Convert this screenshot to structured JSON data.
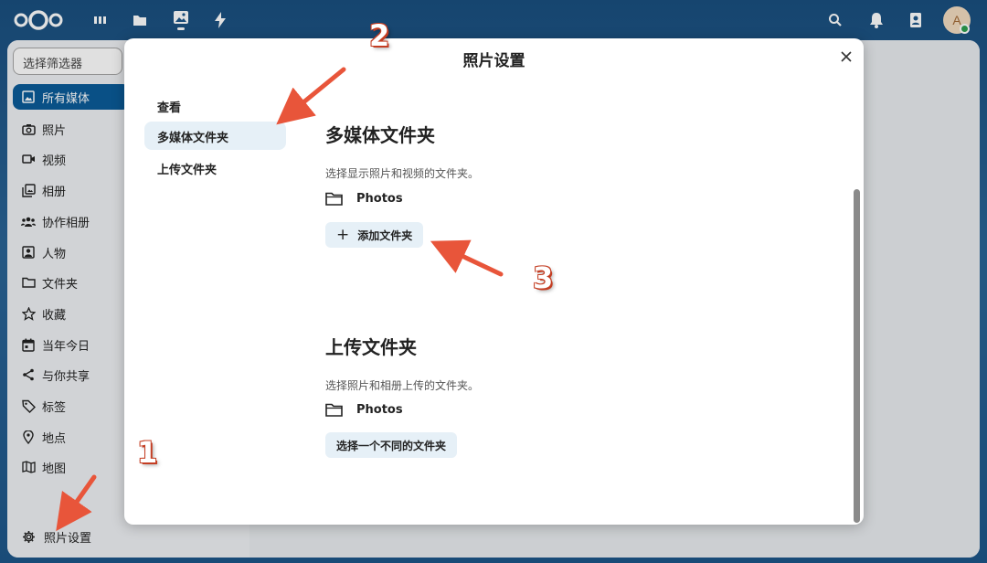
{
  "topbar": {
    "nav_icons": [
      "dashboard-icon",
      "files-icon",
      "photos-icon",
      "activity-icon"
    ],
    "right_icons": [
      "search-icon",
      "notifications-icon",
      "contacts-icon"
    ],
    "avatar_initial": "A"
  },
  "sidebar": {
    "filter_placeholder": "选择筛选器",
    "items": [
      {
        "label": "所有媒体",
        "icon": "image-icon",
        "active": true
      },
      {
        "label": "照片",
        "icon": "camera-icon"
      },
      {
        "label": "视频",
        "icon": "video-icon"
      },
      {
        "label": "相册",
        "icon": "album-icon"
      },
      {
        "label": "协作相册",
        "icon": "shared-album-icon"
      },
      {
        "label": "人物",
        "icon": "person-icon"
      },
      {
        "label": "文件夹",
        "icon": "folder-icon"
      },
      {
        "label": "收藏",
        "icon": "star-icon"
      },
      {
        "label": "当年今日",
        "icon": "calendar-icon"
      },
      {
        "label": "与你共享",
        "icon": "share-icon"
      },
      {
        "label": "标签",
        "icon": "tag-icon"
      },
      {
        "label": "地点",
        "icon": "location-icon"
      },
      {
        "label": "地图",
        "icon": "map-icon"
      }
    ],
    "settings_label": "照片设置"
  },
  "modal": {
    "title": "照片设置",
    "nav": [
      {
        "label": "查看"
      },
      {
        "label": "多媒体文件夹",
        "active": true
      },
      {
        "label": "上传文件夹"
      }
    ],
    "media_section": {
      "title": "多媒体文件夹",
      "description": "选择显示照片和视频的文件夹。",
      "folder": "Photos",
      "add_button": "添加文件夹"
    },
    "upload_section": {
      "title": "上传文件夹",
      "description": "选择照片和相册上传的文件夹。",
      "folder": "Photos",
      "choose_button": "选择一个不同的文件夹"
    }
  },
  "annotations": [
    "1",
    "2",
    "3"
  ],
  "colors": {
    "header_bg": "#1d5689",
    "accent": "#0b5c99",
    "annotation": "#e8553a",
    "button_bg": "#e6f0f7"
  }
}
